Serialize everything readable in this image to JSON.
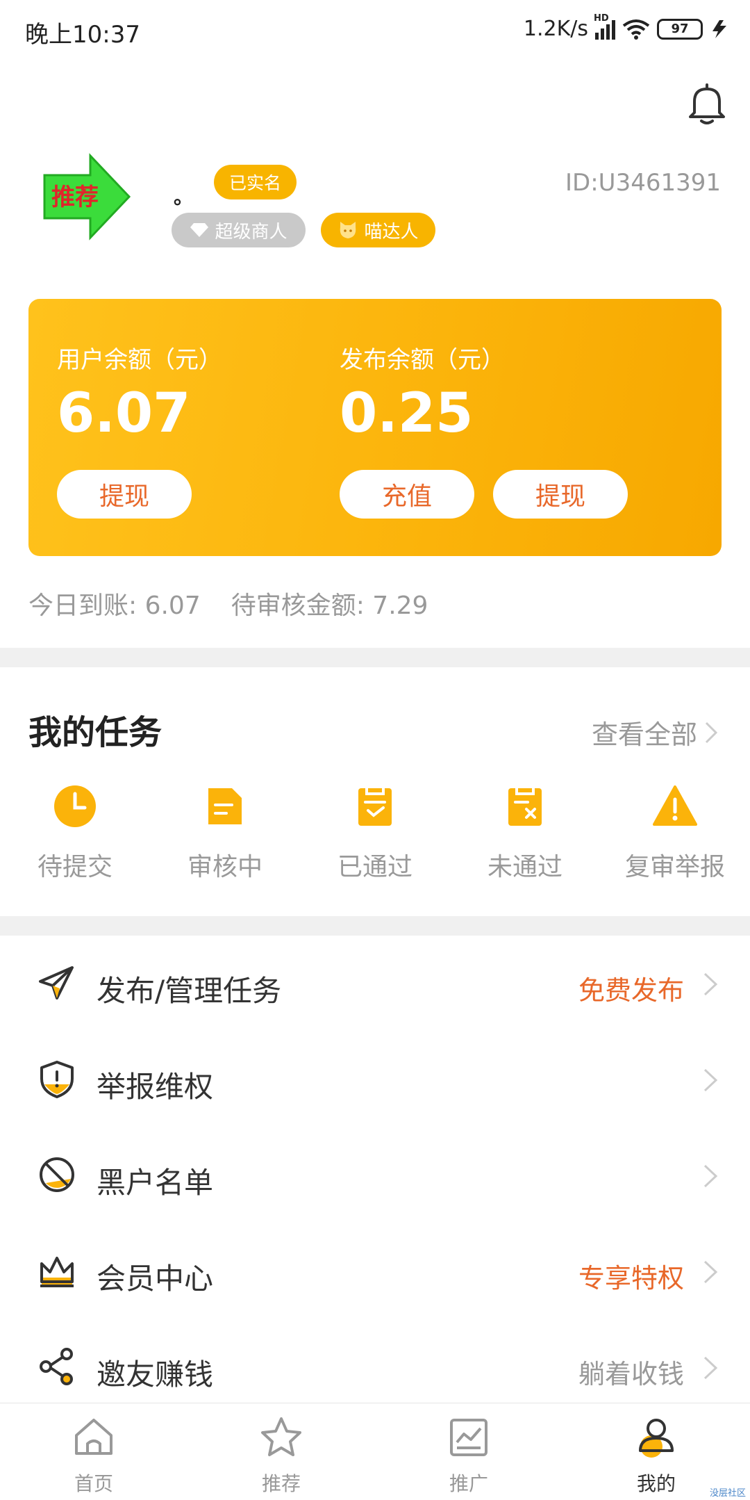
{
  "status_bar": {
    "time": "晚上10:37",
    "network_speed": "1.2K/s",
    "signal_tag": "HD",
    "battery": "97"
  },
  "profile": {
    "nickname": "。",
    "verified_badge": "已实名",
    "user_id": "ID:U3461391",
    "level_badges": [
      "超级商人",
      "喵达人"
    ],
    "avatar_text": "推荐"
  },
  "balance_card": {
    "user_balance_label": "用户余额（元）",
    "user_balance": "6.07",
    "publish_balance_label": "发布余额（元）",
    "publish_balance": "0.25",
    "withdraw_label": "提现",
    "recharge_label": "充值"
  },
  "summary": {
    "today_arrival": "今日到账: 6.07",
    "pending_amount": "待审核金额: 7.29"
  },
  "my_tasks": {
    "title": "我的任务",
    "view_all": "查看全部",
    "items": [
      {
        "label": "待提交",
        "icon": "clock-icon"
      },
      {
        "label": "审核中",
        "icon": "document-icon"
      },
      {
        "label": "已通过",
        "icon": "clipboard-check-icon"
      },
      {
        "label": "未通过",
        "icon": "clipboard-x-icon"
      },
      {
        "label": "复审举报",
        "icon": "warning-icon"
      }
    ]
  },
  "menu": [
    {
      "label": "发布/管理任务",
      "right": "免费发布",
      "icon": "paper-plane-icon"
    },
    {
      "label": "举报维权",
      "right": "",
      "icon": "shield-alert-icon"
    },
    {
      "label": "黑户名单",
      "right": "",
      "icon": "ban-icon"
    },
    {
      "label": "会员中心",
      "right": "专享特权",
      "icon": "crown-icon"
    },
    {
      "label": "邀友赚钱",
      "right": "躺着收钱",
      "icon": "share-icon"
    }
  ],
  "tabbar": [
    {
      "label": "首页",
      "icon": "home-icon"
    },
    {
      "label": "推荐",
      "icon": "star-icon"
    },
    {
      "label": "推广",
      "icon": "chart-icon"
    },
    {
      "label": "我的",
      "icon": "user-icon",
      "active": true
    }
  ],
  "watermark": "没层社区",
  "colors": {
    "accent": "#f8b400",
    "orange_text": "#e8682a",
    "muted": "#999999"
  }
}
